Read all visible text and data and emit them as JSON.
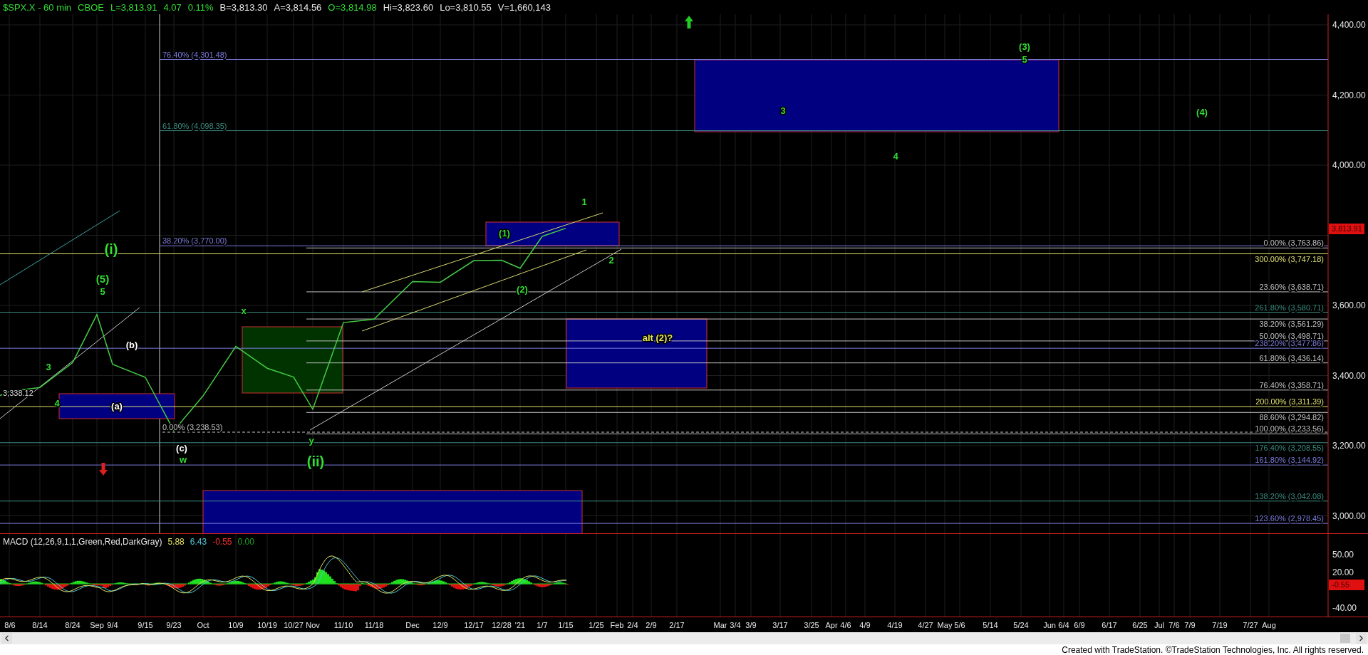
{
  "header": [
    {
      "text": "$SPX.X - 60 min",
      "color": "#33dd33"
    },
    {
      "text": "CBOE",
      "color": "#33dd33"
    },
    {
      "text": "L=3,813.91",
      "color": "#33dd33"
    },
    {
      "text": "4.07",
      "color": "#33dd33"
    },
    {
      "text": "0.11%",
      "color": "#33dd33"
    },
    {
      "text": "B=3,813.30",
      "color": "#e8e8e8"
    },
    {
      "text": "A=3,814.56",
      "color": "#e8e8e8"
    },
    {
      "text": "O=3,814.98",
      "color": "#33dd33"
    },
    {
      "text": "Hi=3,823.60",
      "color": "#e8e8e8"
    },
    {
      "text": "Lo=3,810.55",
      "color": "#e8e8e8"
    },
    {
      "text": "V=1,660,143",
      "color": "#e8e8e8"
    }
  ],
  "price_chart": {
    "date_labels": [
      "8/6",
      "8/14",
      "8/24",
      "Sep",
      "9/4",
      "9/15",
      "9/23",
      "Oct",
      "10/9",
      "10/19",
      "10/27",
      "Nov",
      "11/10",
      "11/18",
      "Dec",
      "12/9",
      "12/17",
      "12/28",
      "'21",
      "1/7",
      "1/15",
      "1/25",
      "Feb",
      "2/4",
      "2/9",
      "2/17",
      "Mar",
      "3/4",
      "3/9",
      "3/17",
      "3/25",
      "Apr",
      "4/6",
      "4/9",
      "4/19",
      "4/27",
      "May",
      "5/6",
      "5/14",
      "5/24",
      "Jun",
      "6/4",
      "6/9",
      "6/17",
      "6/25",
      "Jul",
      "7/6",
      "7/9",
      "7/19",
      "7/27",
      "Aug"
    ],
    "price_axis_labels": [
      "4,400.00",
      "4,200.00",
      "4,000.00",
      "3,600.00",
      "3,400.00",
      "3,200.00",
      "3,000.00"
    ],
    "last_price_tag": "3,813.91",
    "left_price_label": "3,338.12",
    "fib_levels": [
      {
        "label": "76.40% (4,301.48)",
        "color": "#7b7bdc"
      },
      {
        "label": "61.80% (4,098.35)",
        "color": "#3c8c80"
      },
      {
        "label": "38.20% (3,770.00)",
        "color": "#7b7bdc"
      },
      {
        "label": "0.00% (3,763.86)",
        "color": "#c0c0c0"
      },
      {
        "label": "300.00% (3,747.18)",
        "color": "#e0e070"
      },
      {
        "label": "23.60% (3,638.71)",
        "color": "#c0c0c0"
      },
      {
        "label": "261.80% (3,580.71)",
        "color": "#3c8c80"
      },
      {
        "label": "38.20% (3,561.29)",
        "color": "#c0c0c0"
      },
      {
        "label": "50.00% (3,498.71)",
        "color": "#c0c0c0"
      },
      {
        "label": "238.20% (3,477.86)",
        "color": "#7b7bdc"
      },
      {
        "label": "61.80% (3,436.14)",
        "color": "#c0c0c0"
      },
      {
        "label": "76.40% (3,358.71)",
        "color": "#c0c0c0"
      },
      {
        "label": "200.00% (3,311.39)",
        "color": "#e0e070"
      },
      {
        "label": "88.60% (3,294.82)",
        "color": "#c0c0c0"
      },
      {
        "label": "0.00% (3,238.53)",
        "color": "#c0c0c0"
      },
      {
        "label": "100.00% (3,233.56)",
        "color": "#c0c0c0"
      },
      {
        "label": "176.40% (3,208.55)",
        "color": "#3c8c80"
      },
      {
        "label": "161.80% (3,144.92)",
        "color": "#7b7bdc"
      },
      {
        "label": "138.20% (3,042.08)",
        "color": "#3c8c80"
      },
      {
        "label": "123.60% (2,978.45)",
        "color": "#7b7bdc"
      }
    ],
    "wave_labels": [
      {
        "text": "(3)",
        "color": "#33dd33"
      },
      {
        "text": "5",
        "color": "#33dd33"
      },
      {
        "text": "3",
        "color": "#33dd33"
      },
      {
        "text": "(4)",
        "color": "#33dd33"
      },
      {
        "text": "4",
        "color": "#33dd33"
      },
      {
        "text": "1",
        "color": "#33dd33"
      },
      {
        "text": "(1)",
        "color": "#33dd33"
      },
      {
        "text": "(i)",
        "color": "#33dd33"
      },
      {
        "text": "2",
        "color": "#33dd33"
      },
      {
        "text": "(5)",
        "color": "#33dd33"
      },
      {
        "text": "5",
        "color": "#33dd33"
      },
      {
        "text": "(2)",
        "color": "#33dd33"
      },
      {
        "text": "x",
        "color": "#33dd33"
      },
      {
        "text": "alt (2)?",
        "color": "#e8e860"
      },
      {
        "text": "(b)",
        "color": "#ffffff"
      },
      {
        "text": "3",
        "color": "#33dd33"
      },
      {
        "text": "4",
        "color": "#33dd33"
      },
      {
        "text": "(a)",
        "color": "#ffffff"
      },
      {
        "text": "y",
        "color": "#33dd33"
      },
      {
        "text": "(c)",
        "color": "#ffffff"
      },
      {
        "text": "w",
        "color": "#33dd33"
      },
      {
        "text": "(ii)",
        "color": "#33dd33"
      }
    ]
  },
  "macd": {
    "label": "MACD (12,26,9,1,1,Green,Red,DarkGray)",
    "readings": [
      {
        "text": "5.88",
        "color": "#e0e060"
      },
      {
        "text": "6.43",
        "color": "#50c8d8"
      },
      {
        "text": "-0.55",
        "color": "#ff3030"
      },
      {
        "text": "0.00",
        "color": "#20a020"
      }
    ],
    "axis_labels": [
      "50.00",
      "20.00",
      "-40.00"
    ],
    "value_tag": "-0.55"
  },
  "footer": "Created with TradeStation. ©TradeStation Technologies, Inc. All rights reserved."
}
